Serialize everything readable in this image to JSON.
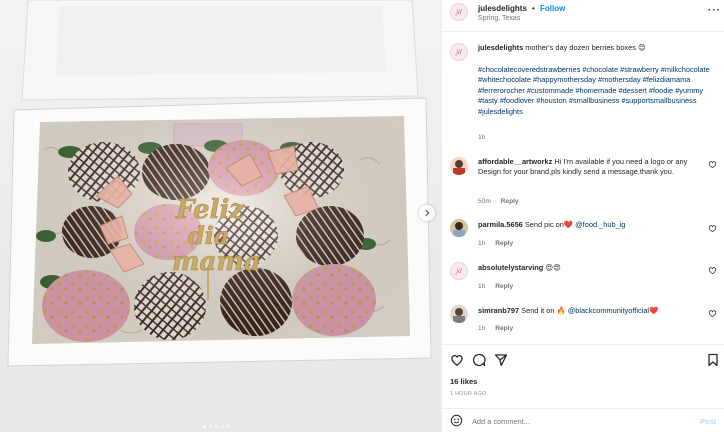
{
  "header": {
    "username": "julesdelights",
    "separator": "•",
    "follow_label": "Follow",
    "location": "Spring, Texas",
    "more_label": "···",
    "avatar_mono": "jd"
  },
  "caption": {
    "username": "julesdelights",
    "text": "mother's day dozen berries boxes 😊",
    "hashtags": "#chocolatecoveredstrawberries #chocolate #strawberry #milkchocolate #whitechocolate #happymothersday #mothersday #felizdiamama #ferrerorocher #custommade #homemade #dessert #foodie #yummy #tasty #foodlover #houston #smallbusiness #supportsmallbusiness #julesdelights",
    "time": "1h"
  },
  "photo": {
    "topper_line1": "Feliz",
    "topper_line2": "dia",
    "topper_line3": "mama"
  },
  "comments": [
    {
      "username": "affordable__artworkz",
      "text": "Hi I'm available if you need a logo or any Design for your brand,pls kindly send a message,thank you.",
      "time": "50m",
      "reply_label": "Reply"
    },
    {
      "username": "parmila.5656",
      "text": "Send pic on❤️",
      "mention": "@food._hub_ig",
      "time": "1h",
      "reply_label": "Reply"
    },
    {
      "username": "absolutelystarving",
      "text": "😍😍",
      "time": "1h",
      "reply_label": "Reply"
    },
    {
      "username": "simranb797",
      "text": "Send it on 🔥",
      "mention": "@blackcommunityofficial❤️",
      "time": "1h",
      "reply_label": "Reply"
    }
  ],
  "actions": {
    "likes": "16 likes",
    "post_time": "1 HOUR AGO"
  },
  "add_comment": {
    "placeholder": "Add a comment...",
    "post_label": "Post"
  },
  "carousel": {
    "slide_count": 5,
    "active_slide": 1
  },
  "colors": {
    "link_blue": "#0095f6",
    "hashtag_blue": "#00376b",
    "muted_grey": "#737373",
    "post_disabled": "#b2dffc",
    "strawberry_pink": "#e89bb3"
  }
}
